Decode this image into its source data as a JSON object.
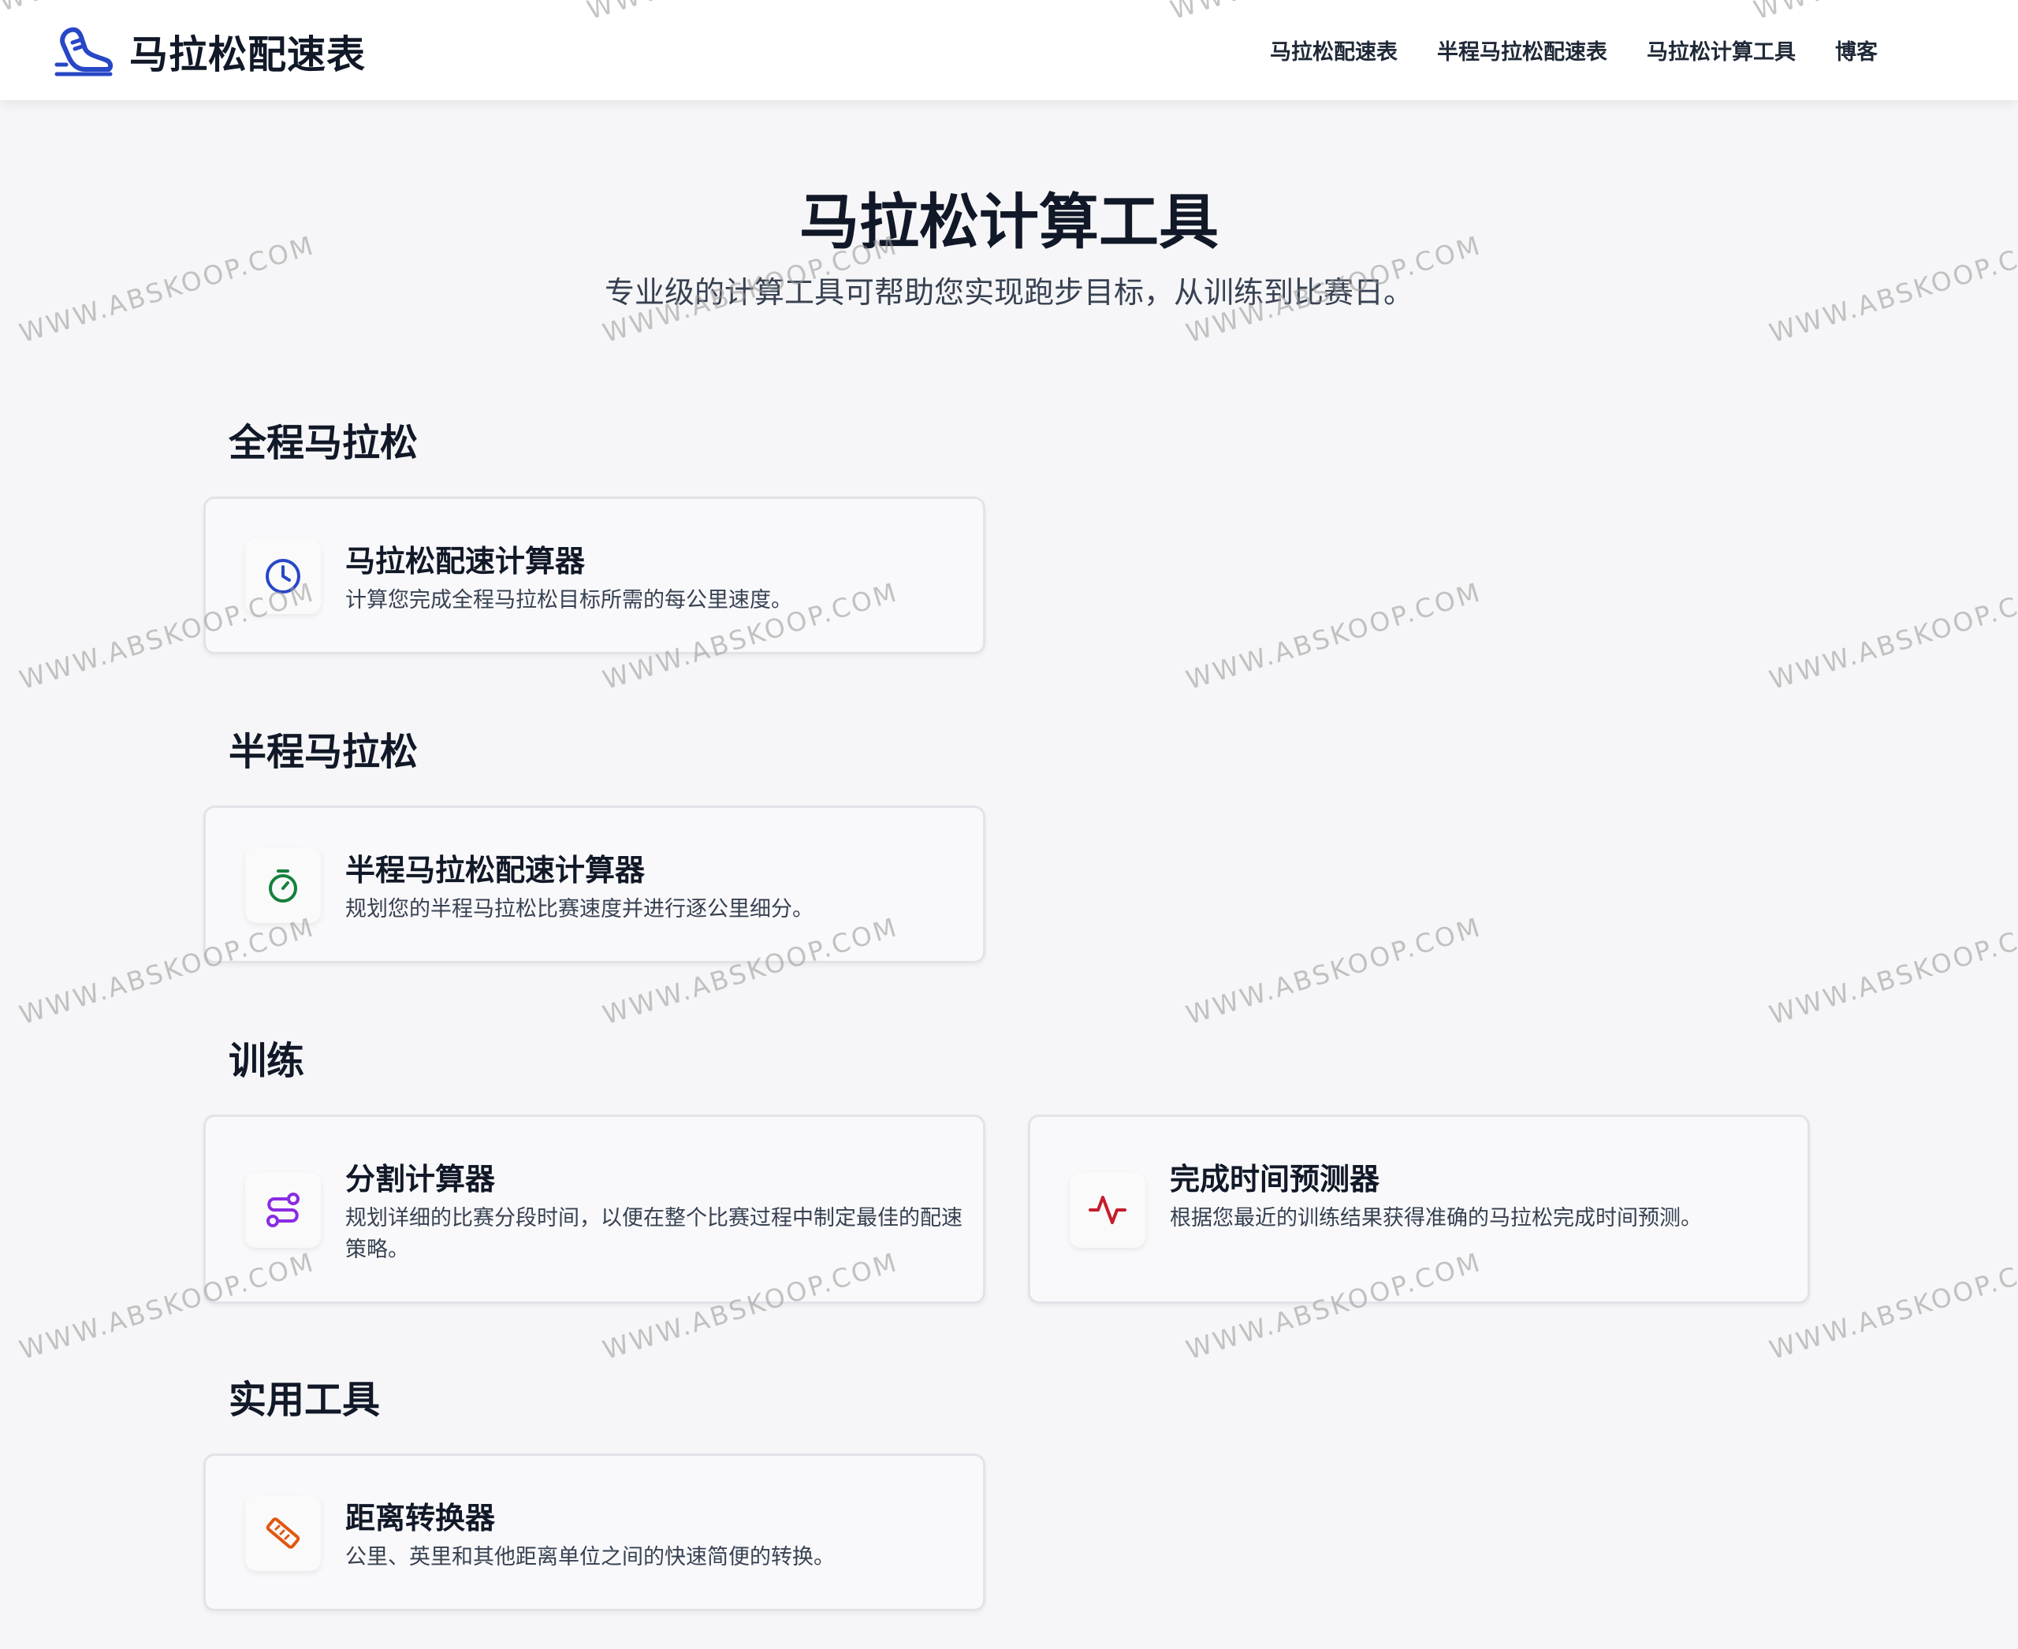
{
  "header": {
    "brand": "马拉松配速表",
    "nav": [
      "马拉松配速表",
      "半程马拉松配速表",
      "马拉松计算工具",
      "博客"
    ]
  },
  "hero": {
    "title": "马拉松计算工具",
    "subtitle": "专业级的计算工具可帮助您实现跑步目标，从训练到比赛日。"
  },
  "sections": [
    {
      "title": "全程马拉松",
      "cards": [
        {
          "title": "马拉松配速计算器",
          "desc": "计算您完成全程马拉松目标所需的每公里速度。",
          "icon": "clock-icon",
          "color": "#2847c7"
        }
      ]
    },
    {
      "title": "半程马拉松",
      "cards": [
        {
          "title": "半程马拉松配速计算器",
          "desc": "规划您的半程马拉松比赛速度并进行逐公里细分。",
          "icon": "stopwatch-icon",
          "color": "#16803c"
        }
      ]
    },
    {
      "title": "训练",
      "cards": [
        {
          "title": "分割计算器",
          "desc": "规划详细的比赛分段时间，以便在整个比赛过程中制定最佳的配速策略。",
          "icon": "route-icon",
          "color": "#8a2be2"
        },
        {
          "title": "完成时间预测器",
          "desc": "根据您最近的训练结果获得准确的马拉松完成时间预测。",
          "icon": "activity-icon",
          "color": "#c41d2c"
        }
      ]
    },
    {
      "title": "实用工具",
      "cards": [
        {
          "title": "距离转换器",
          "desc": "公里、英里和其他距离单位之间的快速简便的转换。",
          "icon": "ruler-icon",
          "color": "#e0570f"
        }
      ]
    }
  ],
  "watermark": "WWW.ABSKOOP.COM"
}
